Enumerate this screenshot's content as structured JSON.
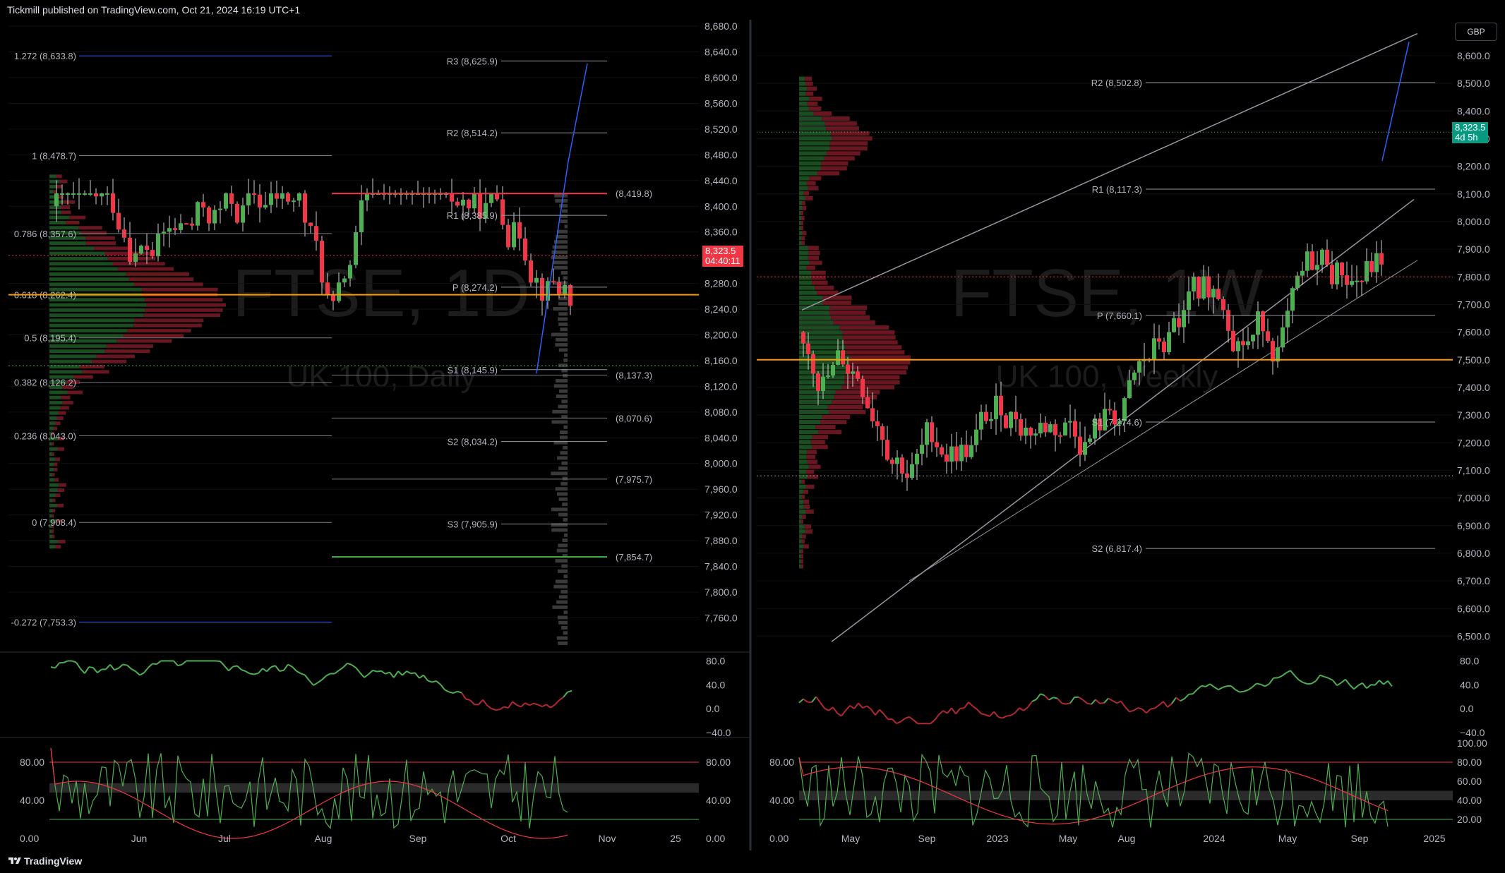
{
  "header": {
    "text": "Tickmill published on TradingView.com, Oct 21, 2024 16:19 UTC+1"
  },
  "footer": {
    "brand": "TradingView"
  },
  "currency_button": "GBP",
  "colors": {
    "up": "#4caf50",
    "down": "#f23645",
    "bg": "#000000",
    "grid": "#1a1a1a",
    "orange": "#ff9800",
    "blue": "#2962ff"
  },
  "chart_data": [
    {
      "type": "candlestick",
      "title": "FTSE, 1D",
      "subtitle": "UK 100, Daily",
      "y_axis": {
        "ticks": [
          "8,680.0",
          "8,640.0",
          "8,600.0",
          "8,560.0",
          "8,520.0",
          "8,480.0",
          "8,440.0",
          "8,400.0",
          "8,360.0",
          "8,320.0",
          "8,280.0",
          "8,240.0",
          "8,200.0",
          "8,160.0",
          "8,120.0",
          "8,080.0",
          "8,040.0",
          "8,000.0",
          "7,960.0",
          "7,920.0",
          "7,880.0",
          "7,840.0",
          "7,800.0",
          "7,760.0"
        ],
        "range": [
          7710,
          8690
        ]
      },
      "x_axis": {
        "ticks": [
          "Jun",
          "Jul",
          "Aug",
          "Sep",
          "Oct",
          "Nov",
          "25"
        ]
      },
      "last_price": {
        "value": "8,323.5",
        "countdown": "04:40:11"
      },
      "fib_levels": [
        {
          "label": "1.272 (8,633.8)",
          "value": 8633.8
        },
        {
          "label": "1 (8,478.7)",
          "value": 8478.7
        },
        {
          "label": "0.786 (8,357.6)",
          "value": 8357.6
        },
        {
          "label": "0.618 (8,262.4)",
          "value": 8262.4
        },
        {
          "label": "0.5 (8,195.4)",
          "value": 8195.4
        },
        {
          "label": "0.382 (8,126.2)",
          "value": 8126.2
        },
        {
          "label": "0.236 (8,043.0)",
          "value": 8043.0
        },
        {
          "label": "0 (7,908.4)",
          "value": 7908.4
        },
        {
          "label": "-0.272 (7,753.3)",
          "value": 7753.3
        }
      ],
      "pivot_levels": [
        {
          "label": "R3 (8,625.9)",
          "value": 8625.9
        },
        {
          "label": "R2 (8,514.2)",
          "value": 8514.2
        },
        {
          "label": "R1 (8,385.9)",
          "value": 8385.9
        },
        {
          "label": "P (8,274.2)",
          "value": 8274.2
        },
        {
          "label": "S1 (8,145.9)",
          "value": 8145.9
        },
        {
          "label": "S2 (8,034.2)",
          "value": 8034.2
        },
        {
          "label": "S3 (7,905.9)",
          "value": 7905.9
        }
      ],
      "side_levels": [
        {
          "label": "(8,419.8)",
          "value": 8419.8,
          "color": "#f23645"
        },
        {
          "label": "(8,137.3)",
          "value": 8137.3,
          "color": "#787b86"
        },
        {
          "label": "(8,070.6)",
          "value": 8070.6,
          "color": "#787b86"
        },
        {
          "label": "(7,975.7)",
          "value": 7975.7,
          "color": "#787b86"
        },
        {
          "label": "(7,854.7)",
          "value": 7854.7,
          "color": "#4caf50"
        }
      ],
      "oscillator_ticks": [
        "80.0",
        "40.0",
        "0.0",
        "−40.0"
      ],
      "stoch_ticks": [
        "80.00",
        "40.00",
        "0.00"
      ],
      "stoch_right_ticks": [
        "80.00",
        "40.00",
        "0.00"
      ]
    },
    {
      "type": "candlestick",
      "title": "FTSE, 1W",
      "subtitle": "UK 100, Weekly",
      "y_axis": {
        "ticks": [
          "8,600.0",
          "8,500.0",
          "8,400.0",
          "8,300.0",
          "8,200.0",
          "8,100.0",
          "8,000.0",
          "7,900.0",
          "7,800.0",
          "7,700.0",
          "7,600.0",
          "7,500.0",
          "7,400.0",
          "7,300.0",
          "7,200.0",
          "7,100.0",
          "7,000.0",
          "6,900.0",
          "6,800.0",
          "6,700.0",
          "6,600.0",
          "6,500.0"
        ],
        "range": [
          6450,
          8730
        ]
      },
      "x_axis": {
        "ticks": [
          "May",
          "Sep",
          "2023",
          "May",
          "Aug",
          "2024",
          "May",
          "Sep",
          "2025"
        ]
      },
      "last_price": {
        "value": "8,323.5",
        "countdown": "4d 5h"
      },
      "pivot_levels": [
        {
          "label": "R2 (8,502.8)",
          "value": 8502.8
        },
        {
          "label": "R1 (8,117.3)",
          "value": 8117.3
        },
        {
          "label": "P (7,660.1)",
          "value": 7660.1
        },
        {
          "label": "S1 (7,274.6)",
          "value": 7274.6
        },
        {
          "label": "S2 (6,817.4)",
          "value": 6817.4
        }
      ],
      "oscillator_ticks": [
        "80.0",
        "40.0",
        "0.0",
        "−40.0"
      ],
      "stoch_ticks": [
        "80.00",
        "40.00",
        "0.00"
      ],
      "stoch_right_ticks": [
        "100.00",
        "80.00",
        "60.00",
        "40.00",
        "20.00"
      ]
    }
  ]
}
